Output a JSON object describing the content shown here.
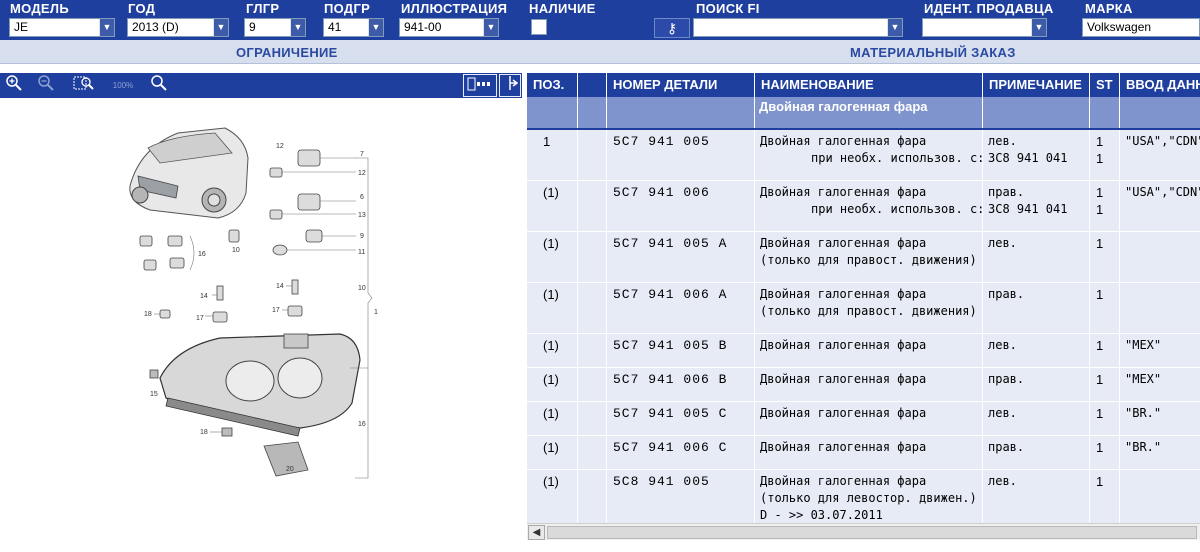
{
  "filters": {
    "model": {
      "label": "МОДЕЛЬ",
      "value": "JE"
    },
    "year": {
      "label": "ГОД",
      "value": "2013 (D)"
    },
    "glgr": {
      "label": "ГЛГР",
      "value": "9"
    },
    "podgr": {
      "label": "ПОДГР",
      "value": "41"
    },
    "illustration": {
      "label": "ИЛЛЮСТРАЦИЯ",
      "value": "941-00"
    },
    "availability": {
      "label": "НАЛИЧИЕ"
    },
    "search_fi": {
      "label": "ПОИСК FI",
      "value": ""
    },
    "seller_id": {
      "label": "ИДЕНТ. ПРОДАВЦА",
      "value": ""
    },
    "brand": {
      "label": "МАРКА",
      "value": "Volkswagen"
    }
  },
  "sub_header": {
    "left_title": "ОГРАНИЧЕНИЕ",
    "right_title": "МАТЕРИАЛЬНЫЙ ЗАКАЗ"
  },
  "toolbar": {
    "zoom_in": "zoom-in-icon",
    "zoom_out": "zoom-out-icon",
    "zoom_area": "zoom-area-icon",
    "zoom_100_label": "100%",
    "search": "search-icon",
    "panel_toggle": "panel-icon",
    "split_toggle": "split-arrows-icon"
  },
  "diagram_labels": {
    "n12a": "12",
    "n7": "7",
    "n12b": "12",
    "n6": "6",
    "n13": "13",
    "n9": "9",
    "n11": "11",
    "n10a": "10",
    "n16a": "16",
    "n10b": "10",
    "n1": "1",
    "n14a": "14",
    "n14b": "14",
    "n18": "18",
    "n17a": "17",
    "n17b": "17",
    "n15": "15",
    "n16b": "16",
    "n18b": "18",
    "n20": "20"
  },
  "table": {
    "headers": {
      "pos": "ПОЗ.",
      "part_number": "НОМЕР ДЕТАЛИ",
      "name": "НАИМЕНОВАНИЕ",
      "note": "ПРИМЕЧАНИЕ",
      "st": "ST",
      "data_entry": "ВВОД ДАНН"
    },
    "group_title": "Двойная галогенная фара",
    "rows": [
      {
        "pos": "1",
        "part": "5C7  941  005",
        "name1": "Двойная галогенная фара",
        "name2": "при необх. использов. с:",
        "note1": "лев.",
        "note2": "3C8 941 041",
        "st1": "1",
        "st2": "1",
        "data": "\"USA\",\"CDN\""
      },
      {
        "pos": "(1)",
        "part": "5C7  941  006",
        "name1": "Двойная галогенная фара",
        "name2": "при необх. использов. с:",
        "note1": "прав.",
        "note2": "3C8 941 041",
        "st1": "1",
        "st2": "1",
        "data": "\"USA\",\"CDN\""
      },
      {
        "pos": "(1)",
        "part": "5C7  941  005  A",
        "name1": "Двойная галогенная фара",
        "name2": "(только для правост. движения)",
        "note1": "лев.",
        "st1": "1"
      },
      {
        "pos": "(1)",
        "part": "5C7  941  006  A",
        "name1": "Двойная галогенная фара",
        "name2": "(только для правост. движения)",
        "note1": "прав.",
        "st1": "1"
      },
      {
        "pos": "(1)",
        "part": "5C7  941  005  B",
        "name1": "Двойная галогенная фара",
        "note1": "лев.",
        "st1": "1",
        "data": "\"MEX\""
      },
      {
        "pos": "(1)",
        "part": "5C7  941  006  B",
        "name1": "Двойная галогенная фара",
        "note1": "прав.",
        "st1": "1",
        "data": "\"MEX\""
      },
      {
        "pos": "(1)",
        "part": "5C7  941  005  C",
        "name1": "Двойная галогенная фара",
        "note1": "лев.",
        "st1": "1",
        "data": "\"BR.\""
      },
      {
        "pos": "(1)",
        "part": "5C7  941  006  C",
        "name1": "Двойная галогенная фара",
        "note1": "прав.",
        "st1": "1",
        "data": "\"BR.\""
      },
      {
        "pos": "(1)",
        "part": "5C8  941  005",
        "name1": "Двойная галогенная фара",
        "name2": "(только для левостор. движен.)",
        "name3": "D -            >>   03.07.2011",
        "note1": "лев.",
        "st1": "1"
      }
    ]
  },
  "colors": {
    "header_blue": "#1f3f9e",
    "row_bg": "#e6ebf5",
    "group_bg": "#7f93cc",
    "subbar_bg": "#d7dfee"
  }
}
